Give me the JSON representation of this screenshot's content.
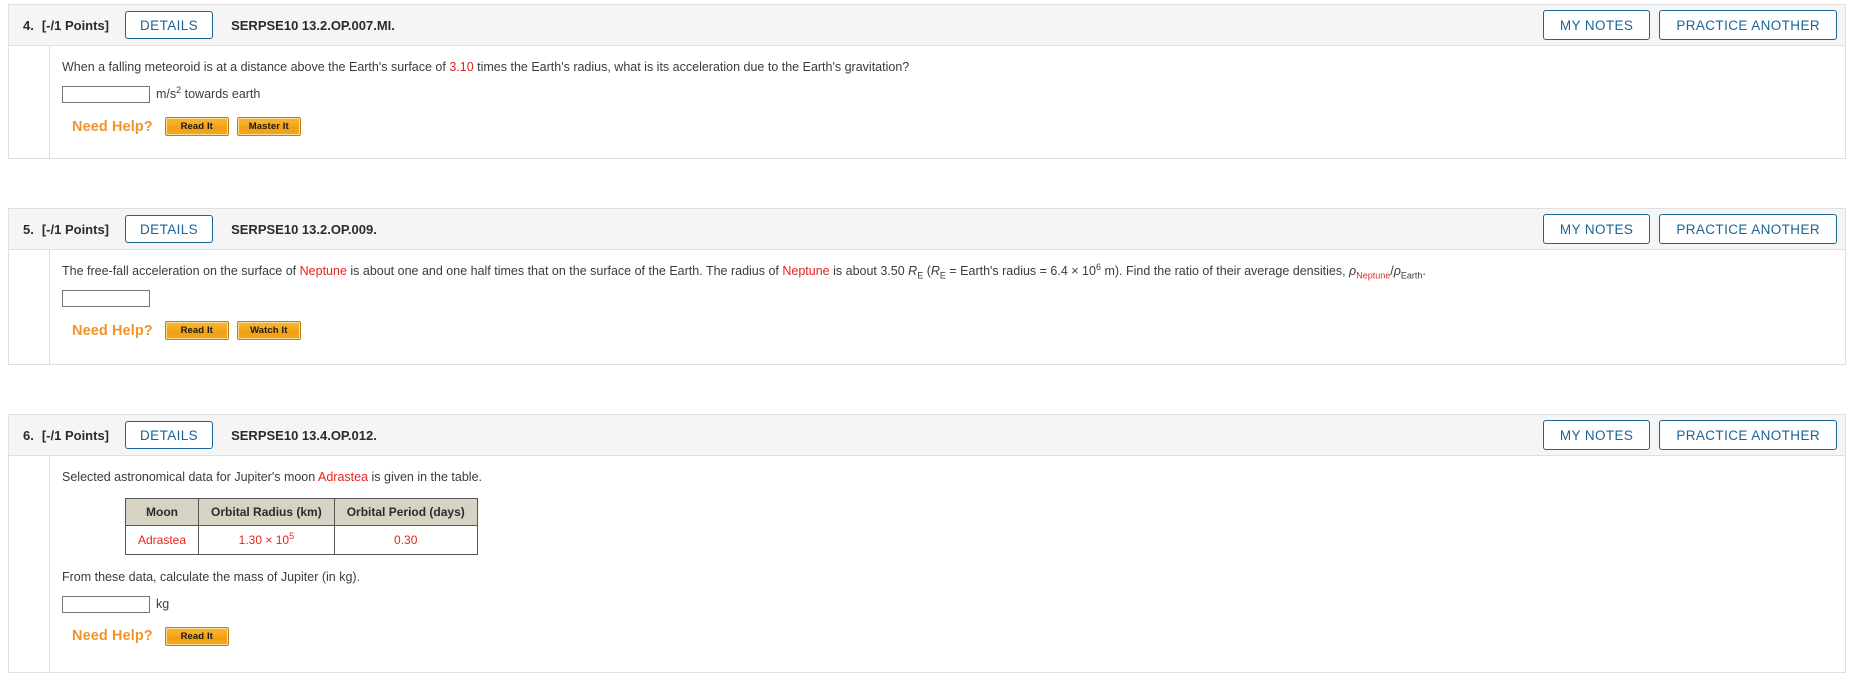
{
  "questions": [
    {
      "number": "4.",
      "points": "[-/1 Points]",
      "details_label": "DETAILS",
      "code": "SERPSE10 13.2.OP.007.MI.",
      "my_notes_label": "MY NOTES",
      "practice_another_label": "PRACTICE ANOTHER",
      "prompt_part1": "When a falling meteoroid is at a distance above the Earth's surface of ",
      "prompt_value": "3.10",
      "prompt_part2": " times the Earth's radius, what is its acceleration due to the Earth's gravitation?",
      "answer_value": "",
      "unit_base": "m/s",
      "unit_exp": "2",
      "unit_tail": " towards earth",
      "need_help_label": "Need Help?",
      "help_buttons": [
        "Read It",
        "Master It"
      ]
    },
    {
      "number": "5.",
      "points": "[-/1 Points]",
      "details_label": "DETAILS",
      "code": "SERPSE10 13.2.OP.009.",
      "my_notes_label": "MY NOTES",
      "practice_another_label": "PRACTICE ANOTHER",
      "prompt_a": "The free-fall acceleration on the surface of ",
      "planet": "Neptune",
      "prompt_b": " is about one and one half times that on the surface of the Earth. The radius of ",
      "planet2": "Neptune",
      "prompt_c": " is about 3.50 ",
      "r_symbol": "R",
      "r_sub": "E",
      "prompt_d": " (",
      "r_symbol2": "R",
      "r_sub2": "E",
      "prompt_e": " = Earth's radius = 6.4 × 10",
      "exp6": "6",
      "prompt_f": " m). Find the ratio of their average densities, ",
      "rho1": "ρ",
      "rho1_sub": "Neptune",
      "slash": "/",
      "rho2": "ρ",
      "rho2_sub": "Earth",
      "period": ".",
      "answer_value": "",
      "need_help_label": "Need Help?",
      "help_buttons": [
        "Read It",
        "Watch It"
      ]
    },
    {
      "number": "6.",
      "points": "[-/1 Points]",
      "details_label": "DETAILS",
      "code": "SERPSE10 13.4.OP.012.",
      "my_notes_label": "MY NOTES",
      "practice_another_label": "PRACTICE ANOTHER",
      "prompt_a": "Selected astronomical data for Jupiter's moon ",
      "moon": "Adrastea",
      "prompt_b": " is given in the table.",
      "table": {
        "headers": [
          "Moon",
          "Orbital Radius (km)",
          "Orbital Period (days)"
        ],
        "rows": [
          {
            "moon": "Adrastea",
            "radius_mantissa": "1.30 × 10",
            "radius_exp": "5",
            "period": "0.30"
          }
        ]
      },
      "prompt_after": "From these data, calculate the mass of Jupiter (in kg).",
      "answer_value": "",
      "unit": "kg",
      "need_help_label": "Need Help?",
      "help_buttons": [
        "Read It"
      ]
    }
  ],
  "colors": {
    "accent_blue": "#1a6496",
    "highlight_red": "#e8231f",
    "help_orange": "#f2942a",
    "header_bg": "#f5f5f5",
    "table_header_bg": "#d8d2c4"
  }
}
